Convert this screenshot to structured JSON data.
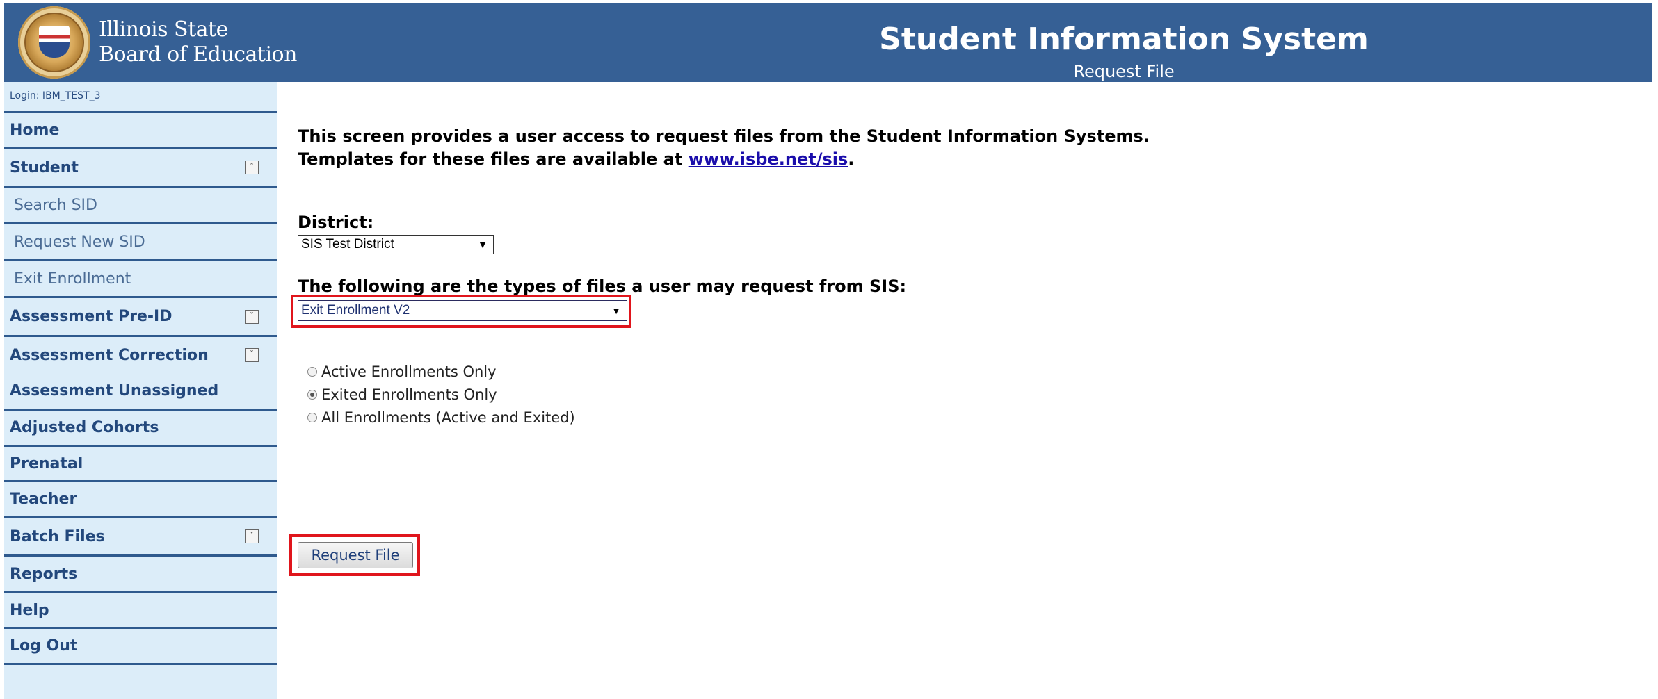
{
  "header": {
    "org_line1": "Illinois State",
    "org_line2": "Board of Education",
    "app_title": "Student Information System",
    "page_subtitle": "Request File",
    "seal_icon": "illinois-state-seal"
  },
  "sidebar": {
    "login": "Login: IBM_TEST_3",
    "items": [
      {
        "label": "Home"
      },
      {
        "label": "Student",
        "toggle": "collapse"
      },
      {
        "label": "Search SID"
      },
      {
        "label": "Request New SID"
      },
      {
        "label": "Exit Enrollment"
      },
      {
        "label": "Assessment Pre-ID",
        "toggle": "expand"
      },
      {
        "label": "Assessment Correction",
        "toggle": "expand"
      },
      {
        "label": "Assessment Unassigned"
      },
      {
        "label": "Adjusted Cohorts"
      },
      {
        "label": "Prenatal"
      },
      {
        "label": "Teacher"
      },
      {
        "label": "Batch Files",
        "toggle": "expand"
      },
      {
        "label": "Reports"
      },
      {
        "label": "Help"
      },
      {
        "label": "Log Out"
      }
    ]
  },
  "main": {
    "intro_line1": "This screen provides a user access to request files from the Student Information Systems.",
    "intro_line2_prefix": "Templates for these files are available at ",
    "intro_link": "www.isbe.net/sis",
    "intro_line2_suffix": ".",
    "district_label": "District:",
    "district_value": "SIS Test District",
    "file_types_label": "The following are the types of files a user may request from SIS:",
    "file_type_value": "Exit Enrollment V2",
    "radio_options": [
      {
        "label": "Active Enrollments Only",
        "selected": false
      },
      {
        "label": "Exited Enrollments Only",
        "selected": true
      },
      {
        "label": "All Enrollments (Active and Exited)",
        "selected": false
      }
    ],
    "request_button": "Request File"
  },
  "colors": {
    "header_bg": "#366095",
    "sidebar_bg": "#dcedf9",
    "nav_text": "#23487c",
    "highlight": "#e0151c"
  }
}
